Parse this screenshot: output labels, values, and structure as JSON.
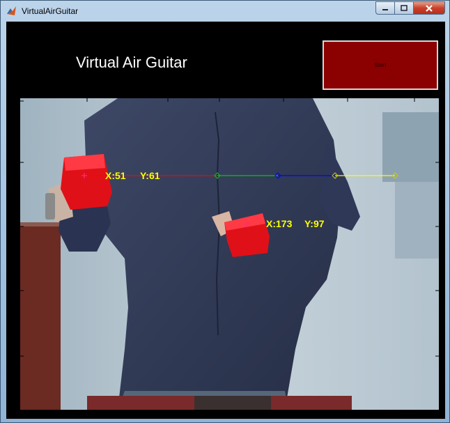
{
  "window": {
    "title": "VirtualAirGuitar"
  },
  "header": {
    "title": "Virtual Air Guitar",
    "start_label": "Start"
  },
  "video": {
    "string_colors": [
      "#ff0000",
      "#00cc00",
      "#0000ff",
      "#ffff00"
    ],
    "left_marker": {
      "x_label": "X:51",
      "y_label": "Y:61"
    },
    "right_marker": {
      "x_label": "X:173",
      "y_label": "Y:97"
    }
  },
  "icons": [
    "matlab-icon",
    "minimize-icon",
    "maximize-icon",
    "close-icon",
    "plus-marker-icon",
    "diamond-marker-icon"
  ]
}
